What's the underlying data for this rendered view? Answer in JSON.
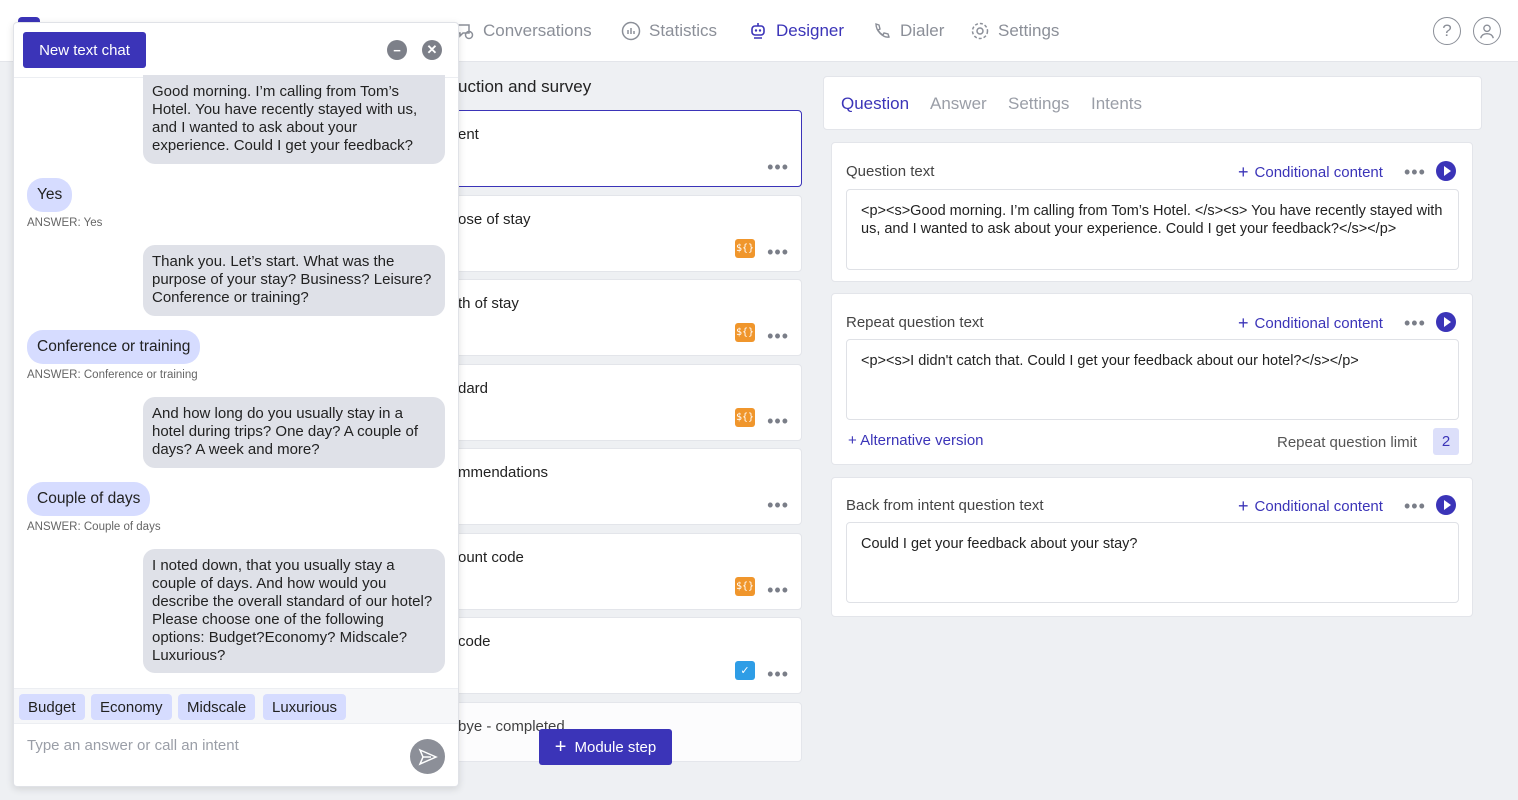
{
  "nav": {
    "items": [
      {
        "label": "Conversations",
        "icon": "chat-icon",
        "active": false
      },
      {
        "label": "Statistics",
        "icon": "chart-icon",
        "active": false
      },
      {
        "label": "Designer",
        "icon": "robot-icon",
        "active": true
      },
      {
        "label": "Dialer",
        "icon": "phone-icon",
        "active": false
      },
      {
        "label": "Settings",
        "icon": "gear-icon",
        "active": false
      }
    ],
    "help_glyph": "?"
  },
  "steps": {
    "title": "uction and survey",
    "items": [
      {
        "label": "ent",
        "badge": ""
      },
      {
        "label": "ose of stay",
        "badge": "var"
      },
      {
        "label": "th of stay",
        "badge": "var"
      },
      {
        "label": "dard",
        "badge": "var"
      },
      {
        "label": "mmendations",
        "badge": ""
      },
      {
        "label": "ount code",
        "badge": "var"
      },
      {
        "label": "code",
        "badge": "check"
      },
      {
        "label": "bye - completed",
        "badge": ""
      }
    ],
    "module_step_label": "Module step",
    "var_badge_text": "${}"
  },
  "editor": {
    "tabs": [
      "Question",
      "Answer",
      "Settings",
      "Intents"
    ],
    "active_tab": "Question",
    "conditional_label": "Conditional content",
    "question": {
      "label": "Question text",
      "value": "<p><s>Good morning. I’m calling from Tom’s Hotel. </s><s> You have recently stayed with us, and I wanted to ask about your experience. Could I get your feedback?</s></p>"
    },
    "repeat": {
      "label": "Repeat question text",
      "value": "<p><s>I didn't catch that. Could I get your feedback about our hotel?</s></p>",
      "alt_version": "Alternative version",
      "limit_label": "Repeat question limit",
      "limit_value": "2"
    },
    "back_from_intent": {
      "label": "Back from intent question text",
      "value": "Could I get your feedback about your stay?"
    }
  },
  "chat": {
    "new_chat_label": "New text chat",
    "messages": [
      {
        "from": "bot",
        "text": "Good morning. I’m calling from Tom’s Hotel. You have recently stayed with us, and I wanted to ask about your experience. Could I get your feedback?"
      },
      {
        "from": "user",
        "text": "Yes",
        "answer": "ANSWER: Yes"
      },
      {
        "from": "bot",
        "text": "Thank you. Let’s start. What was the purpose of your stay? Business? Leisure? Conference or training?"
      },
      {
        "from": "user",
        "text": "Conference or training",
        "answer": "ANSWER: Conference or training"
      },
      {
        "from": "bot",
        "text": "And how long do you usually stay in a hotel during trips? One day? A couple of days? A week and more?"
      },
      {
        "from": "user",
        "text": "Couple of days",
        "answer": "ANSWER: Couple of days"
      },
      {
        "from": "bot",
        "text": "I noted down, that you usually stay a couple of days. And how would you describe the overall standard of our hotel? Please choose one of the following options: Budget?Economy? Midscale?Luxurious?"
      }
    ],
    "quick_replies": [
      "Budget",
      "Economy",
      "Midscale",
      "Luxurious"
    ],
    "input_placeholder": "Type an answer or call an intent"
  },
  "colors": {
    "accent": "#3b34b8",
    "var_badge": "#f0962c",
    "check_badge": "#2e9de6",
    "user_bubble": "#d6dcff",
    "bot_bubble": "#dfe1e8"
  }
}
